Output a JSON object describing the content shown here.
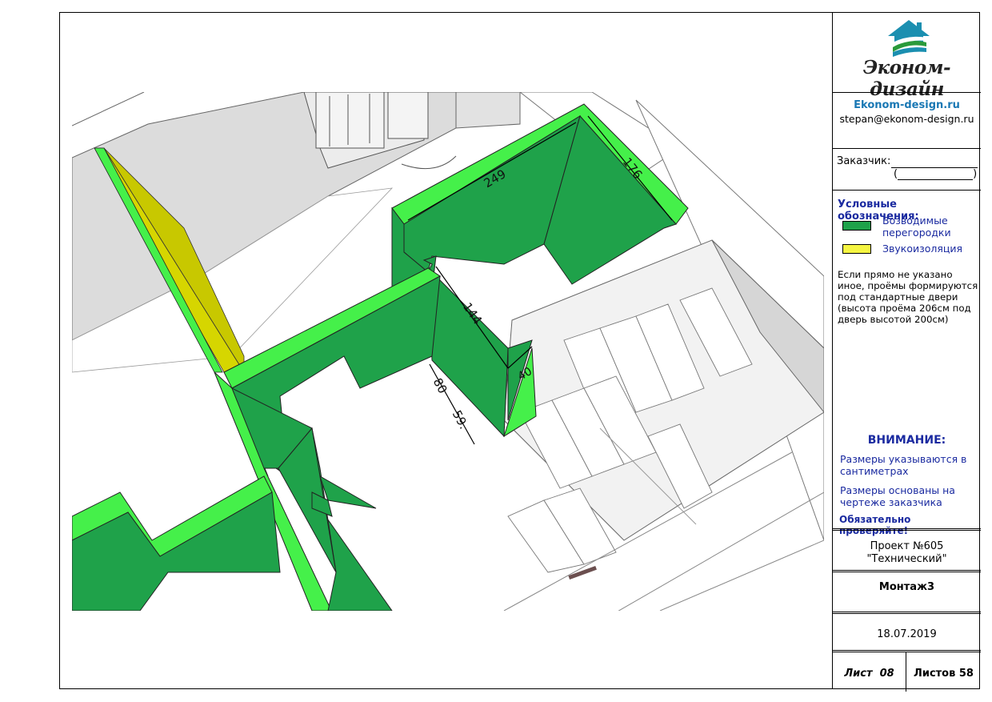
{
  "brand": {
    "name": "Эконом-дизайн",
    "site": "Ekonom-design.ru",
    "email": "stepan@ekonom-design.ru"
  },
  "client": {
    "label": "Заказчик:",
    "paren_open": "(",
    "paren_close": ")"
  },
  "legend": {
    "title": "Условные обозначения:",
    "items": [
      {
        "label": "Возводимые перегородки",
        "color": "#1fa24a"
      },
      {
        "label": "Звукоизоляция",
        "color": "#f5f542"
      }
    ]
  },
  "note": "Если прямо не указано иное, проёмы формируются под стандартные двери (высота проёма 206см под дверь высотой 200см)",
  "attention": {
    "title": "ВНИМАНИЕ:",
    "line1": "Размеры указываются в сантиметрах",
    "line2": "Размеры основаны на чертеже заказчика",
    "line3": "Обязательно проверяйте!"
  },
  "project": {
    "number": "Проект №605",
    "name": "\"Технический\""
  },
  "sheet_title": "Монтаж3",
  "date": "18.07.2019",
  "sheet": {
    "label": "Лист",
    "number": "08"
  },
  "sheets_total": {
    "label": "Листов",
    "number": "58"
  },
  "dimensions": {
    "d249": "249",
    "d176": "176",
    "d144": "144",
    "d40": "40",
    "d80": "80",
    "d59": "59."
  },
  "colors": {
    "wall_green": "#1fa24a",
    "wall_top": "#45f04a",
    "insulation": "#c8c800",
    "accent_blue": "#1a2aa0",
    "link_blue": "#1a78b4"
  }
}
